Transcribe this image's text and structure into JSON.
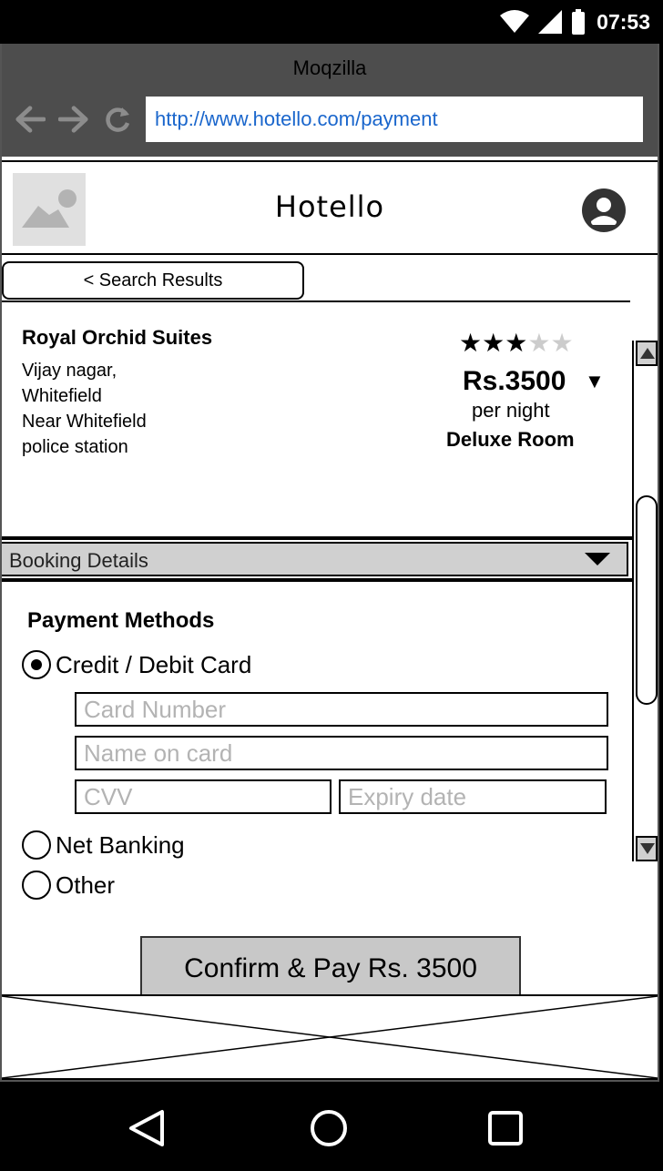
{
  "status_bar": {
    "time": "07:53",
    "icons": [
      "wifi-icon",
      "signal-icon",
      "battery-icon"
    ]
  },
  "browser": {
    "title": "Moqzilla",
    "url": "http://www.hotello.com/payment",
    "nav_icons": [
      "back-arrow-icon",
      "forward-arrow-icon",
      "reload-icon"
    ]
  },
  "app": {
    "title": "Hotello",
    "logo_icon": "image-placeholder-icon",
    "profile_icon": "user-account-icon"
  },
  "breadcrumb": {
    "back_label": "< Search Results"
  },
  "hotel": {
    "name": "Royal Orchid Suites",
    "address_lines": [
      "Vijay nagar,",
      "Whitefield",
      "Near Whitefield",
      "police station"
    ],
    "rating": 3,
    "rating_max": 5,
    "price": "Rs.3500",
    "price_unit": "per night",
    "room_type": "Deluxe Room"
  },
  "booking": {
    "label": "Booking Details"
  },
  "payment": {
    "title": "Payment Methods",
    "methods": [
      {
        "label": "Credit / Debit Card",
        "selected": true
      },
      {
        "label": "Net Banking",
        "selected": false
      },
      {
        "label": "Other",
        "selected": false
      }
    ],
    "card_number_placeholder": "Card Number",
    "name_on_card_placeholder": "Name on card",
    "cvv_placeholder": "CVV",
    "expiry_placeholder": "Expiry date",
    "confirm_label": "Confirm & Pay Rs. 3500"
  },
  "colors": {
    "browser_chrome": "#4d4d4d",
    "url_text": "#1a66cc",
    "button_fill": "#c8c8c8",
    "placeholder_text": "#b3b3b3"
  }
}
